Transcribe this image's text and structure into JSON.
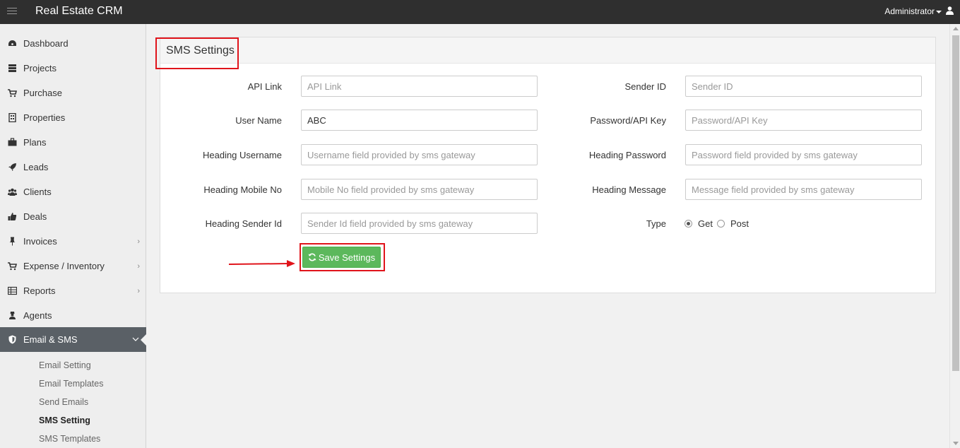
{
  "header": {
    "app_title": "Real Estate CRM",
    "user_menu": "Administrator"
  },
  "sidebar": {
    "items": [
      {
        "label": "Dashboard",
        "icon": "dashboard-icon"
      },
      {
        "label": "Projects",
        "icon": "server-icon"
      },
      {
        "label": "Purchase",
        "icon": "cart-icon"
      },
      {
        "label": "Properties",
        "icon": "building-icon"
      },
      {
        "label": "Plans",
        "icon": "briefcase-icon"
      },
      {
        "label": "Leads",
        "icon": "rocket-icon"
      },
      {
        "label": "Clients",
        "icon": "users-icon"
      },
      {
        "label": "Deals",
        "icon": "thumbs-up-icon"
      },
      {
        "label": "Invoices",
        "icon": "pin-icon"
      },
      {
        "label": "Expense / Inventory",
        "icon": "cart-icon"
      },
      {
        "label": "Reports",
        "icon": "table-icon"
      },
      {
        "label": "Agents",
        "icon": "agent-icon"
      },
      {
        "label": "Email & SMS",
        "icon": "shield-icon"
      }
    ],
    "sub_items": [
      {
        "label": "Email Setting"
      },
      {
        "label": "Email Templates"
      },
      {
        "label": "Send Emails"
      },
      {
        "label": "SMS Setting"
      },
      {
        "label": "SMS Templates"
      }
    ]
  },
  "panel": {
    "title": "SMS Settings"
  },
  "form": {
    "api_link": {
      "label": "API Link",
      "value": "",
      "placeholder": "API Link"
    },
    "sender_id": {
      "label": "Sender ID",
      "value": "",
      "placeholder": "Sender ID"
    },
    "user_name": {
      "label": "User Name",
      "value": "ABC",
      "placeholder": ""
    },
    "password": {
      "label": "Password/API Key",
      "value": "",
      "placeholder": "Password/API Key"
    },
    "heading_username": {
      "label": "Heading Username",
      "value": "",
      "placeholder": "Username field provided by sms gateway"
    },
    "heading_password": {
      "label": "Heading Password",
      "value": "",
      "placeholder": "Password field provided by sms gateway"
    },
    "heading_mobile": {
      "label": "Heading Mobile No",
      "value": "",
      "placeholder": "Mobile No field provided by sms gateway"
    },
    "heading_message": {
      "label": "Heading Message",
      "value": "",
      "placeholder": "Message field provided by sms gateway"
    },
    "heading_sender": {
      "label": "Heading Sender Id",
      "value": "",
      "placeholder": "Sender Id field provided by sms gateway"
    },
    "type": {
      "label": "Type",
      "options": [
        "Get",
        "Post"
      ],
      "selected": "Get"
    },
    "save_label": "Save Settings"
  },
  "colors": {
    "topbar": "#2f2f2f",
    "active_nav": "#5a6066",
    "save_button": "#5cb85c",
    "highlight": "#e0141b"
  }
}
